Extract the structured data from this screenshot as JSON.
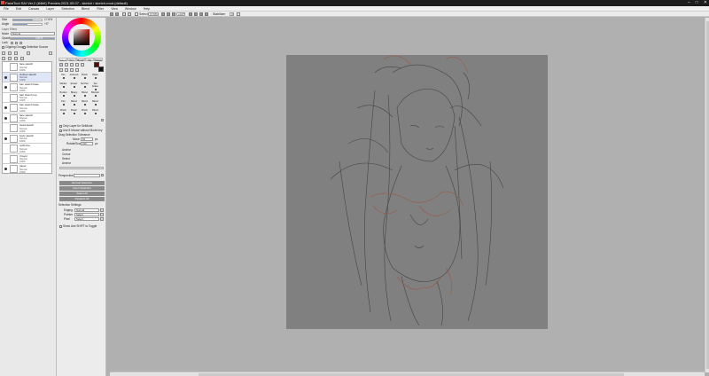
{
  "window": {
    "title": "PaintTool SAI Ver.2 (64bit) Preview.2021.05.07 - sketch / sketch-mod (default)",
    "controls": [
      "–",
      "□",
      "✕"
    ]
  },
  "menubar": [
    "File",
    "Edit",
    "Canvas",
    "Layer",
    "Selection",
    "Blend",
    "Filter",
    "View",
    "Window",
    "Help"
  ],
  "toolbar": {
    "selection_label": "Selection",
    "zoom_value": "17.6%",
    "angle_value": "+0.0°",
    "stabilizer_label": "Stabilizer",
    "stabilizer_value": "3"
  },
  "left_panel": {
    "layer_effect_label": "Layer Effect",
    "mode_label": "Mode",
    "mode_value": "Normal",
    "opacity_label": "Opacity",
    "opacity_value": "100%",
    "opacity_level": 1.0,
    "lock_label": "Lock",
    "clipping_group_label": "Clipping Group",
    "selection_source_label": "Selection Source",
    "brush_size_label": "Size",
    "brush_size_value": "17.6%",
    "angle_label": "Angle",
    "angle_value": "+0°"
  },
  "layers": [
    {
      "name": "face sketch",
      "mode": "Normal",
      "opacity": "100%",
      "visible": false,
      "selected": false
    },
    {
      "name": "clothes sketch",
      "mode": "Normal",
      "opacity": "100%",
      "visible": true,
      "selected": true
    },
    {
      "name": "hair sketch base",
      "mode": "Normal",
      "opacity": "100%",
      "visible": true,
      "selected": false
    },
    {
      "name": "hair sketch top",
      "mode": "Normal",
      "opacity": "100%",
      "visible": false,
      "selected": false
    },
    {
      "name": "hair sketch base",
      "mode": "Normal",
      "opacity": "100%",
      "visible": true,
      "selected": false
    },
    {
      "name": "face sketch",
      "mode": "Normal",
      "opacity": "100%",
      "visible": true,
      "selected": false
    },
    {
      "name": "head sketch",
      "mode": "Normal",
      "opacity": "100%",
      "visible": false,
      "selected": false
    },
    {
      "name": "body sketch",
      "mode": "Normal",
      "opacity": "100%",
      "visible": true,
      "selected": false
    },
    {
      "name": "outfit line",
      "mode": "Normal",
      "opacity": "100%",
      "visible": false,
      "selected": false
    },
    {
      "name": "3 layer",
      "mode": "Normal",
      "opacity": "100%",
      "visible": false,
      "selected": false
    },
    {
      "name": "paper",
      "mode": "Normal",
      "opacity": "100%",
      "visible": true,
      "selected": false
    }
  ],
  "tool_panel": {
    "tabs": [
      "Select",
      "Pen",
      "Brush",
      "Ink",
      "Shape"
    ],
    "tools": [
      [
        "Pen",
        "Airbrush",
        "Brush",
        "Water"
      ],
      [
        "Marker",
        "Eraser",
        "Sel Pen",
        "Sel Erase"
      ],
      [
        "Bucket",
        "Binary",
        "Blend",
        "Blender"
      ],
      [
        "Pen",
        "Blend",
        "Blend",
        "Blend"
      ],
      [
        "Brush",
        "Brush",
        "Brush",
        "Blend"
      ]
    ],
    "selection_note_1": "Only Layer for SelMode",
    "selection_note_2": "Use 8 Mouse without Mode key",
    "drag_section_label": "Drag Selection Tolerance",
    "drag_section_values": [
      {
        "label": "Move",
        "value": "15",
        "unit": "px"
      },
      {
        "label": "Rotate/Scale",
        "value": "100",
        "unit": "px"
      }
    ],
    "options": [
      "Anchor",
      "Cursor",
      "Select",
      "Anchor"
    ],
    "perspective_label": "Perspective",
    "action_buttons": [
      "Normal Selection",
      "Invert Selection",
      "Select All",
      "Deselect All"
    ],
    "selection_settings_label": "Selection Settings",
    "dropdowns": [
      {
        "label": "Edging",
        "value": "Normal"
      },
      {
        "label": "Pointer",
        "value": "Select"
      },
      {
        "label": "Pixel",
        "value": "Select"
      }
    ],
    "bottom_checkbox_label": "Show Use SHIFT to Toggle"
  },
  "colors": {
    "main": "#5a0b06",
    "sub": "#0f0f0f",
    "selected_layer_bg": "#dfe6f7"
  }
}
